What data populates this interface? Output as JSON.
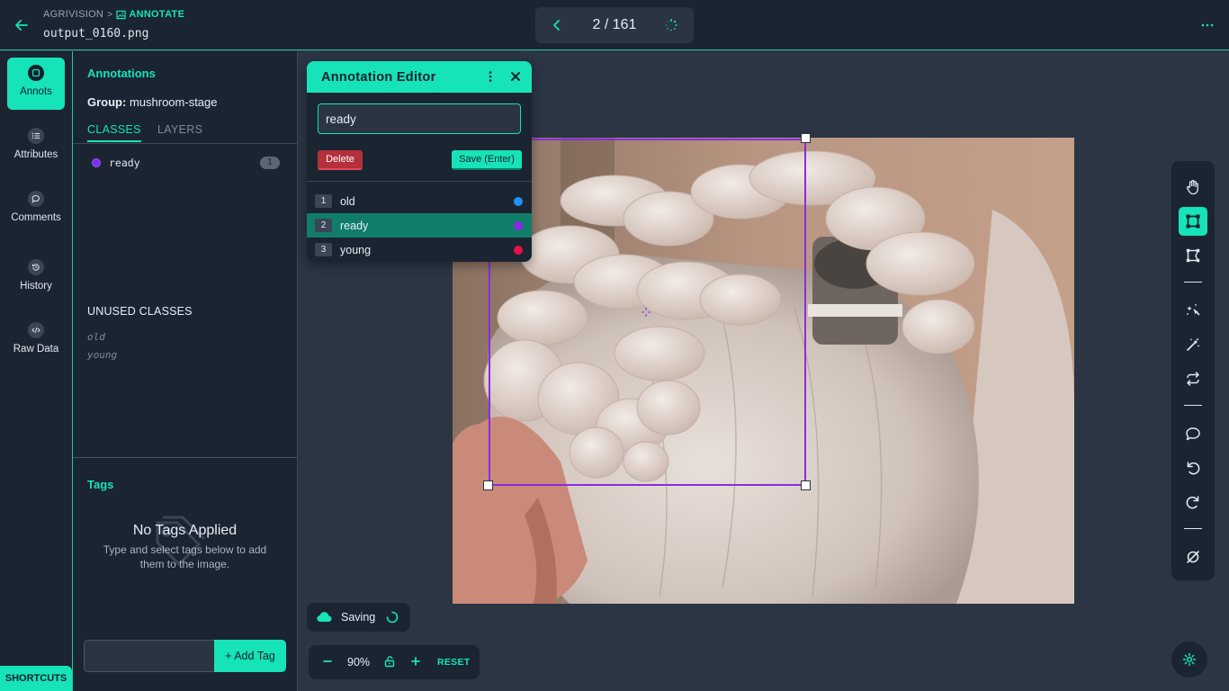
{
  "header": {
    "project": "AGRIVISION",
    "separator": ">",
    "section": "ANNOTATE",
    "filename": "output_0160.png",
    "pager": "2 / 161"
  },
  "rail": {
    "items": [
      {
        "label": "Annots",
        "icon": "annotation-icon",
        "active": true
      },
      {
        "label": "Attributes",
        "icon": "list-icon"
      },
      {
        "label": "Comments",
        "icon": "comment-icon"
      },
      {
        "label": "History",
        "icon": "history-icon"
      },
      {
        "label": "Raw Data",
        "icon": "code-icon"
      }
    ],
    "shortcuts_label": "SHORTCUTS"
  },
  "panel": {
    "title": "Annotations",
    "group_label": "Group:",
    "group_value": "mushroom-stage",
    "tabs": [
      "CLASSES",
      "LAYERS"
    ],
    "classes": [
      {
        "name": "ready",
        "count": "1",
        "color": "#7b2ff2"
      }
    ],
    "unused_title": "UNUSED CLASSES",
    "unused": [
      "old",
      "young"
    ],
    "tags_title": "Tags",
    "no_tags_title": "No Tags Applied",
    "no_tags_text": "Type and select tags below to add them to the image.",
    "tag_input_value": "",
    "add_tag_label": "+ Add Tag"
  },
  "editor": {
    "title": "Annotation Editor",
    "input_value": "ready",
    "delete_label": "Delete",
    "save_label": "Save (Enter)",
    "options": [
      {
        "key": "1",
        "label": "old",
        "color": "#1e90ff"
      },
      {
        "key": "2",
        "label": "ready",
        "color": "#8a2be2",
        "selected": true
      },
      {
        "key": "3",
        "label": "young",
        "color": "#e8114a"
      }
    ]
  },
  "status": {
    "saving": "Saving"
  },
  "zoom": {
    "value": "90%",
    "reset": "RESET"
  },
  "colors": {
    "accent": "#17e3b8",
    "bbox": "#8a2be2",
    "background": "#2b3544",
    "panel": "#1b2431"
  }
}
